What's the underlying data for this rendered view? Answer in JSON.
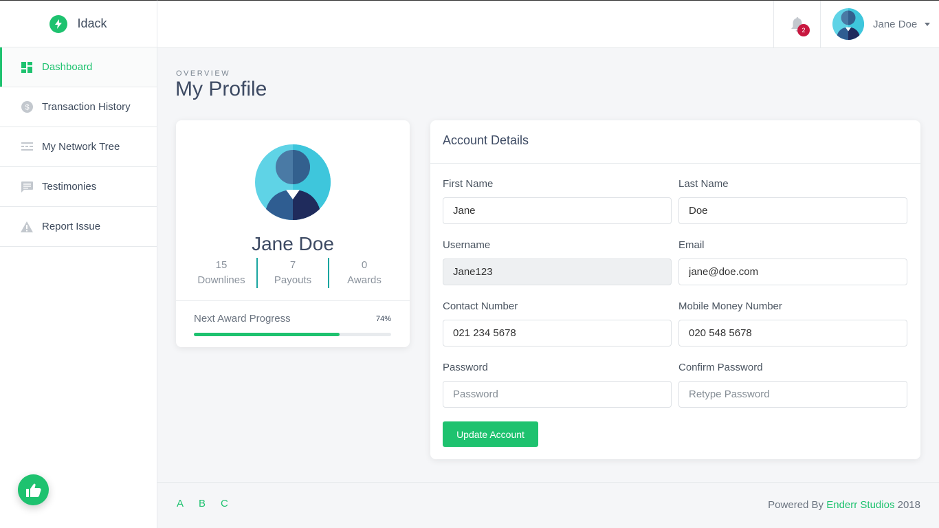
{
  "brand": {
    "name": "Idack",
    "accent": "#1ec26f"
  },
  "sidebar": {
    "items": [
      {
        "label": "Dashboard",
        "icon": "dashboard-icon",
        "active": true
      },
      {
        "label": "Transaction History",
        "icon": "dollar-icon",
        "active": false
      },
      {
        "label": "My Network Tree",
        "icon": "network-icon",
        "active": false
      },
      {
        "label": "Testimonies",
        "icon": "comment-icon",
        "active": false
      },
      {
        "label": "Report Issue",
        "icon": "warning-icon",
        "active": false
      }
    ]
  },
  "topbar": {
    "notifications_count": "2",
    "user_name": "Jane Doe"
  },
  "page": {
    "overline": "OVERVIEW",
    "title": "My Profile"
  },
  "profile": {
    "name": "Jane Doe",
    "stats": [
      {
        "value": "15",
        "label": "Downlines"
      },
      {
        "value": "7",
        "label": "Payouts"
      },
      {
        "value": "0",
        "label": "Awards"
      }
    ],
    "progress_label": "Next Award Progress",
    "progress_text": "74%",
    "progress_value": 0.74
  },
  "account": {
    "title": "Account Details",
    "fields": {
      "first_name": {
        "label": "First Name",
        "value": "Jane"
      },
      "last_name": {
        "label": "Last Name",
        "value": "Doe"
      },
      "username": {
        "label": "Username",
        "value": "Jane123"
      },
      "email": {
        "label": "Email",
        "value": "jane@doe.com"
      },
      "contact": {
        "label": "Contact Number",
        "value": "021 234 5678"
      },
      "mobile_money": {
        "label": "Mobile Money Number",
        "value": "020 548 5678"
      },
      "password": {
        "label": "Password",
        "placeholder": "Password"
      },
      "confirm_password": {
        "label": "Confirm Password",
        "placeholder": "Retype Password"
      }
    },
    "submit_label": "Update Account"
  },
  "footer": {
    "links": [
      "A",
      "B",
      "C"
    ],
    "credit_prefix": "Powered By",
    "credit_brand": "Enderr Studios",
    "credit_year": "2018"
  }
}
